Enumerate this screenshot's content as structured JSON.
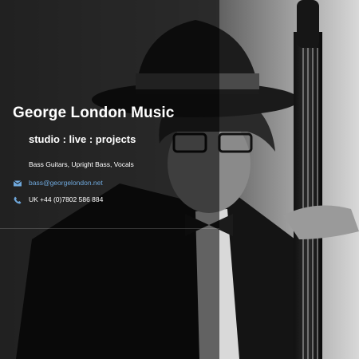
{
  "site": {
    "title": "George London Music",
    "tagline": "studio : live : projects",
    "services": "Bass Guitars, Upright Bass, Vocals"
  },
  "contact": {
    "email": "bass@georgelondon.net",
    "email_href": "mailto:bass@georgelondon.net",
    "phone": "UK +44 (0)7802 586 884"
  },
  "icons": {
    "email": "envelope-icon",
    "phone": "phone-icon"
  },
  "colors": {
    "link": "#6fa8dc",
    "text": "#ffffff"
  }
}
